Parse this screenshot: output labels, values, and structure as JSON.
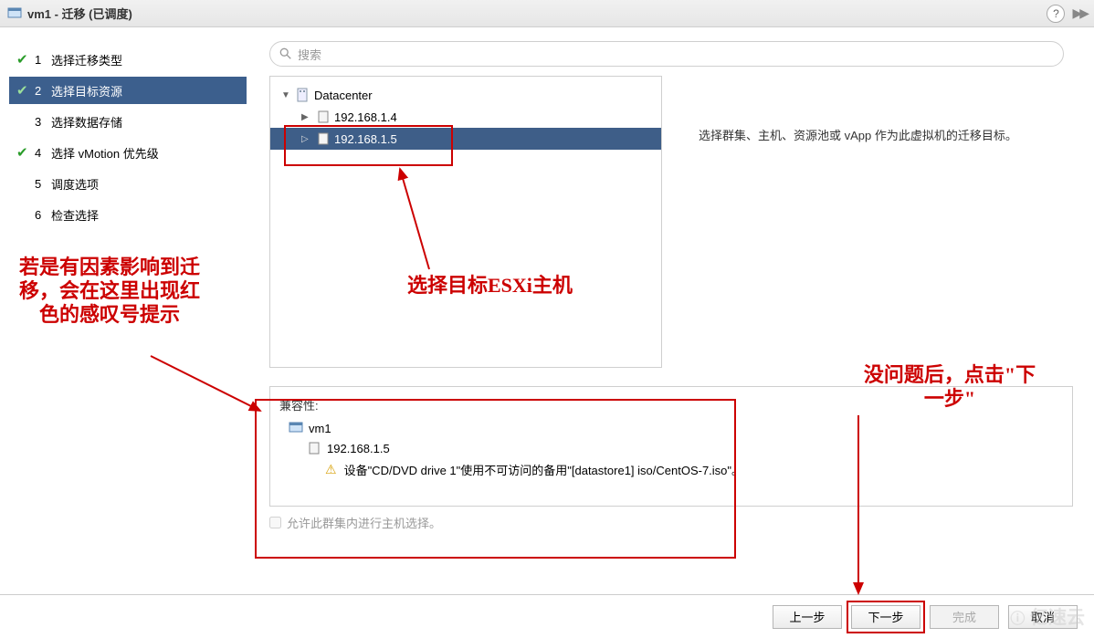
{
  "title": "vm1 - 迁移 (已调度)",
  "nav": {
    "s1": {
      "num": "1",
      "label": "选择迁移类型",
      "checked": true
    },
    "s2": {
      "num": "2",
      "label": "选择目标资源",
      "checked": true
    },
    "s3": {
      "num": "3",
      "label": "选择数据存储",
      "checked": false
    },
    "s4": {
      "num": "4",
      "label": "选择 vMotion 优先级",
      "checked": true
    },
    "s5": {
      "num": "5",
      "label": "调度选项",
      "checked": false
    },
    "s6": {
      "num": "6",
      "label": "检查选择",
      "checked": false
    }
  },
  "search": {
    "placeholder": "搜索",
    "icon_label": "search"
  },
  "tree": {
    "root": "Datacenter",
    "host1": "192.168.1.4",
    "host2": "192.168.1.5"
  },
  "description": "选择群集、主机、资源池或 vApp 作为此虚拟机的迁移目标。",
  "compat": {
    "title": "兼容性:",
    "vm": "vm1",
    "host": "192.168.1.5",
    "warning": "设备\"CD/DVD drive 1\"使用不可访问的备用\"[datastore1] iso/CentOS-7.iso\"。"
  },
  "allow_host_selection": "允许此群集内进行主机选择。",
  "buttons": {
    "back": "上一步",
    "next": "下一步",
    "finish": "完成",
    "cancel": "取消"
  },
  "annotations": {
    "left": "若是有因素影响到迁移，会在这里出现红色的感叹号提示",
    "mid": "选择目标ESXi主机",
    "right": "没问题后，点击\"下一步\""
  },
  "watermark": "亿速云"
}
